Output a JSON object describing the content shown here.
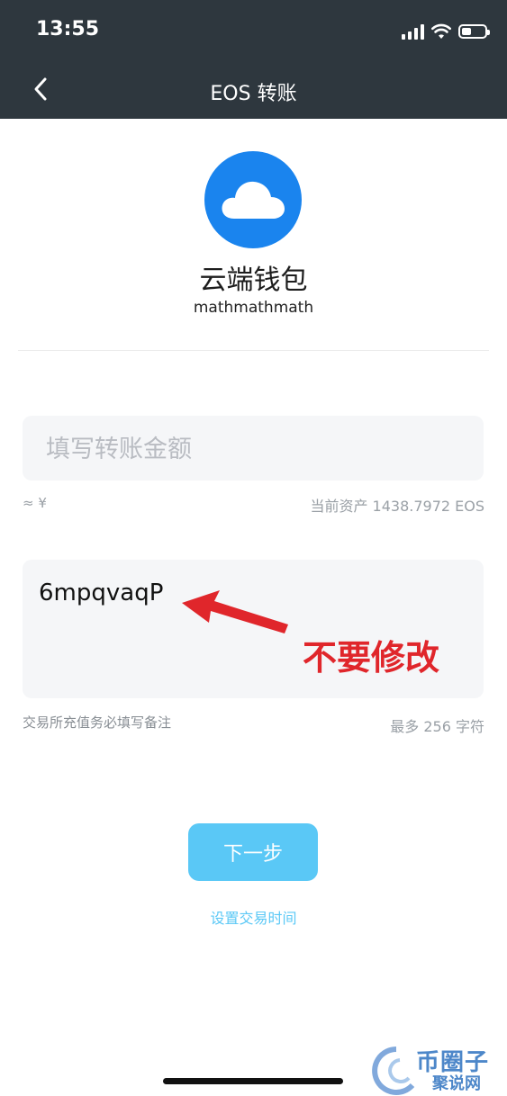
{
  "status_bar": {
    "time": "13:55"
  },
  "header": {
    "title": "EOS 转账"
  },
  "wallet": {
    "name": "云端钱包",
    "account": "mathmathmath"
  },
  "amount": {
    "placeholder": "填写转账金额",
    "fiat": "≈ ¥",
    "balance": "当前资产 1438.7972 EOS"
  },
  "memo": {
    "value": "6mpqvaqP",
    "hint": "交易所充值务必填写备注",
    "limit": "最多 256 字符"
  },
  "annotation": {
    "text": "不要修改",
    "color": "#e0262b"
  },
  "actions": {
    "next_label": "下一步",
    "set_time_label": "设置交易时间"
  },
  "watermark": {
    "main": "币圈子",
    "sub": "聚说网"
  },
  "colors": {
    "header_bg": "#2e373e",
    "accent": "#5ac8f6",
    "avatar_bg": "#1a84ee"
  },
  "icons": {
    "back": "chevron-left-icon",
    "avatar": "cloud-icon",
    "signal": "signal-icon",
    "wifi": "wifi-icon",
    "battery": "battery-icon"
  }
}
